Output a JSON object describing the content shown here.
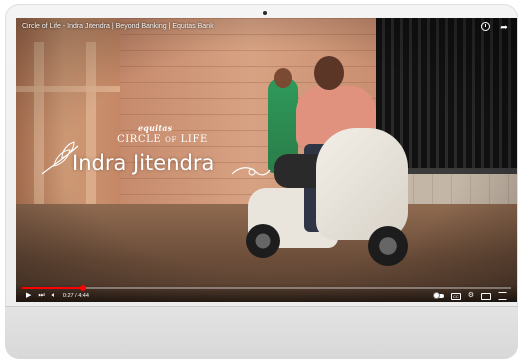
{
  "video": {
    "title": "Circle of Life - Indra Jitendra | Beyond Banking | Equitas Bank",
    "brand_logo": "equitas",
    "brand_tagline": "CIRCLE of LIFE",
    "name_title": "Indra Jitendra",
    "progress": 0.125
  },
  "controls": {
    "time": "0:27 / 4:44",
    "play_icon": "play-icon",
    "next_icon": "next-icon",
    "volume_icon": "volume-icon",
    "autoplay_icon": "autoplay-toggle-icon",
    "captions_icon": "captions-icon",
    "settings_icon": "gear-icon",
    "miniplayer_icon": "miniplayer-icon",
    "fullscreen_icon": "fullscreen-icon"
  },
  "top_icons": [
    "clock-icon",
    "share-icon"
  ],
  "colors": {
    "progress": "#ff0000",
    "overlay_text": "#ffffff",
    "device": "#efefef"
  }
}
